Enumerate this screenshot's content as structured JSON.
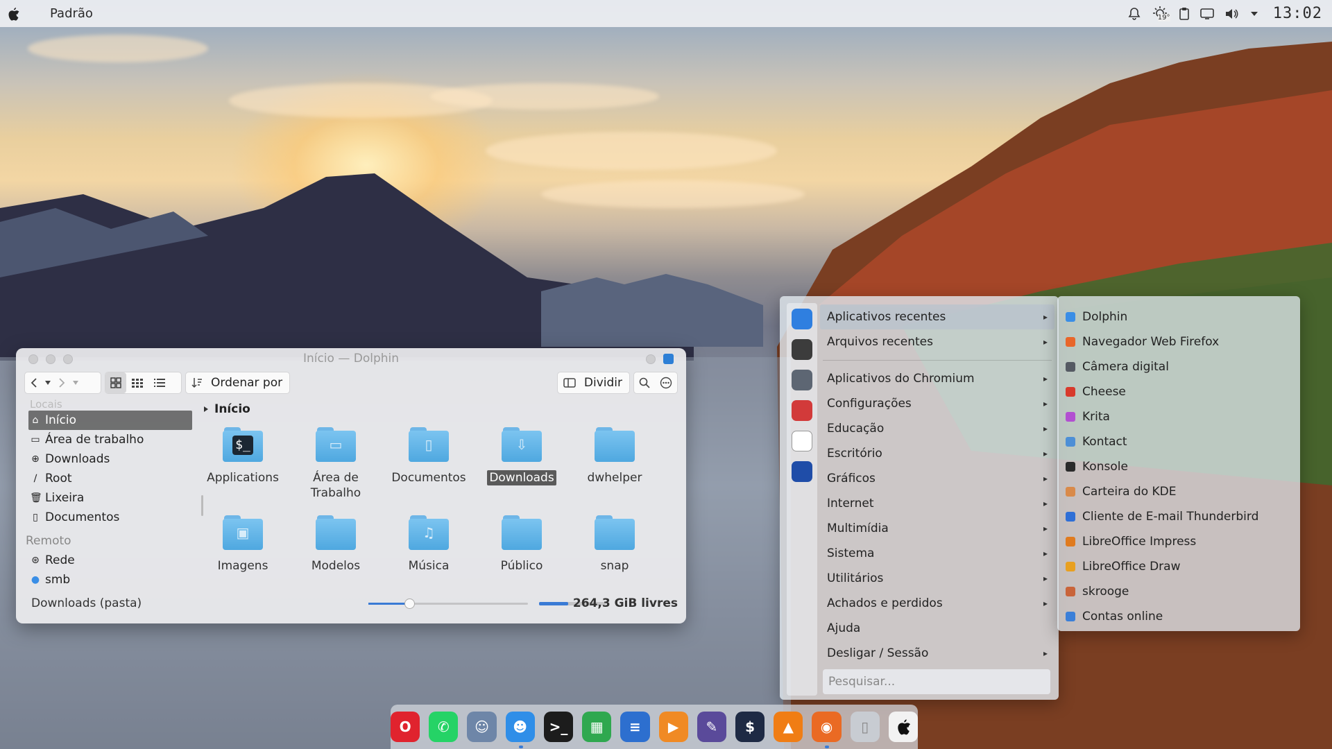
{
  "topbar": {
    "menu_title": "Padrão",
    "clock": "13:02",
    "weather_temp": "19°",
    "icons": [
      "apple-logo-icon",
      "notification-bell-icon",
      "weather-icon",
      "clipboard-icon",
      "display-icon",
      "volume-icon",
      "tray-arrow-icon"
    ]
  },
  "dolphin": {
    "title": "Início — Dolphin",
    "toolbar": {
      "sort_label": "Ordenar por",
      "split_label": "Dividir",
      "view_modes": [
        "icons-view-icon",
        "compact-view-icon",
        "details-view-icon"
      ]
    },
    "sidebar": {
      "places_heading": "Locais",
      "places": [
        {
          "label": "Início",
          "icon": "home-icon",
          "active": true
        },
        {
          "label": "Área de trabalho",
          "icon": "desktop-icon"
        },
        {
          "label": "Downloads",
          "icon": "download-icon"
        },
        {
          "label": "Root",
          "icon": "root-icon"
        },
        {
          "label": "Lixeira",
          "icon": "trash-icon"
        },
        {
          "label": "Documentos",
          "icon": "document-icon"
        }
      ],
      "remote_heading": "Remoto",
      "remote": [
        {
          "label": "Rede",
          "icon": "network-icon"
        },
        {
          "label": "smb",
          "icon": "smb-icon"
        }
      ]
    },
    "breadcrumb": "Início",
    "files": [
      {
        "name": "Applications",
        "icon": "terminal-folder-icon"
      },
      {
        "name": "Área de\nTrabalho",
        "icon": "desktop-folder-icon"
      },
      {
        "name": "Documentos",
        "icon": "documents-folder-icon"
      },
      {
        "name": "Downloads",
        "icon": "downloads-folder-icon",
        "selected": true
      },
      {
        "name": "dwhelper",
        "icon": "folder-icon"
      },
      {
        "name": "Imagens",
        "icon": "pictures-folder-icon"
      },
      {
        "name": "Modelos",
        "icon": "templates-folder-icon"
      },
      {
        "name": "Música",
        "icon": "music-folder-icon"
      },
      {
        "name": "Público",
        "icon": "public-folder-icon"
      },
      {
        "name": "snap",
        "icon": "folder-icon"
      }
    ],
    "status": {
      "selection": "Downloads (pasta)",
      "free_space": "264,3 GiB livres",
      "zoom_fraction": 0.26,
      "used_fraction": 0.44
    }
  },
  "launcher": {
    "favorites": [
      "app-store-icon",
      "kvantum-icon",
      "system-settings-icon",
      "mail-icon",
      "blank-document-icon",
      "shield-icon"
    ],
    "categories": [
      {
        "label": "Aplicativos recentes",
        "highlighted": true
      },
      {
        "label": "Arquivos recentes"
      },
      {
        "label": "Aplicativos do Chromium"
      },
      {
        "label": "Configurações"
      },
      {
        "label": "Educação"
      },
      {
        "label": "Escritório"
      },
      {
        "label": "Gráficos"
      },
      {
        "label": "Internet"
      },
      {
        "label": "Multimídia"
      },
      {
        "label": "Sistema"
      },
      {
        "label": "Utilitários"
      },
      {
        "label": "Achados e perdidos"
      },
      {
        "label": "Ajuda",
        "no_arrow": true
      },
      {
        "label": "Desligar / Sessão"
      }
    ],
    "search_placeholder": "Pesquisar...",
    "recent_apps": [
      {
        "label": "Dolphin",
        "color": "#3a8ee6"
      },
      {
        "label": "Navegador Web Firefox",
        "color": "#e8662a"
      },
      {
        "label": "Câmera digital",
        "color": "#555a63"
      },
      {
        "label": "Cheese",
        "color": "#d83a2c"
      },
      {
        "label": "Krita",
        "color": "#b24fd1"
      },
      {
        "label": "Kontact",
        "color": "#4d8fd6"
      },
      {
        "label": "Konsole",
        "color": "#2b2b2b"
      },
      {
        "label": "Carteira do KDE",
        "color": "#d98a4a"
      },
      {
        "label": "Cliente de E-mail Thunderbird",
        "color": "#2f6fd6"
      },
      {
        "label": "LibreOffice Impress",
        "color": "#e07b1f"
      },
      {
        "label": "LibreOffice Draw",
        "color": "#e8a020"
      },
      {
        "label": "skrooge",
        "color": "#c9643a"
      },
      {
        "label": "Contas online",
        "color": "#3b7fd8"
      }
    ]
  },
  "dock": {
    "apps": [
      {
        "name": "opera-icon",
        "color": "#e0232e"
      },
      {
        "name": "whatsapp-icon",
        "color": "#25d366"
      },
      {
        "name": "contacts-icon",
        "color": "#6e86a8"
      },
      {
        "name": "finder-icon",
        "color": "#2f8ee8",
        "active": true
      },
      {
        "name": "terminal-icon",
        "color": "#1c1c1c"
      },
      {
        "name": "spreadsheet-icon",
        "color": "#2fa84f"
      },
      {
        "name": "writer-icon",
        "color": "#2d6fcf"
      },
      {
        "name": "presentation-icon",
        "color": "#f08a24"
      },
      {
        "name": "krita-icon",
        "color": "#5a4a9a"
      },
      {
        "name": "terminal-x-icon",
        "color": "#1e2a44"
      },
      {
        "name": "vlc-icon",
        "color": "#f07d14"
      },
      {
        "name": "firefox-icon",
        "color": "#ea6a23",
        "active": true
      },
      {
        "name": "trash-icon",
        "color": "#c8ccd2"
      },
      {
        "name": "apple-menu-icon",
        "color": "#f2f2f2"
      }
    ]
  }
}
